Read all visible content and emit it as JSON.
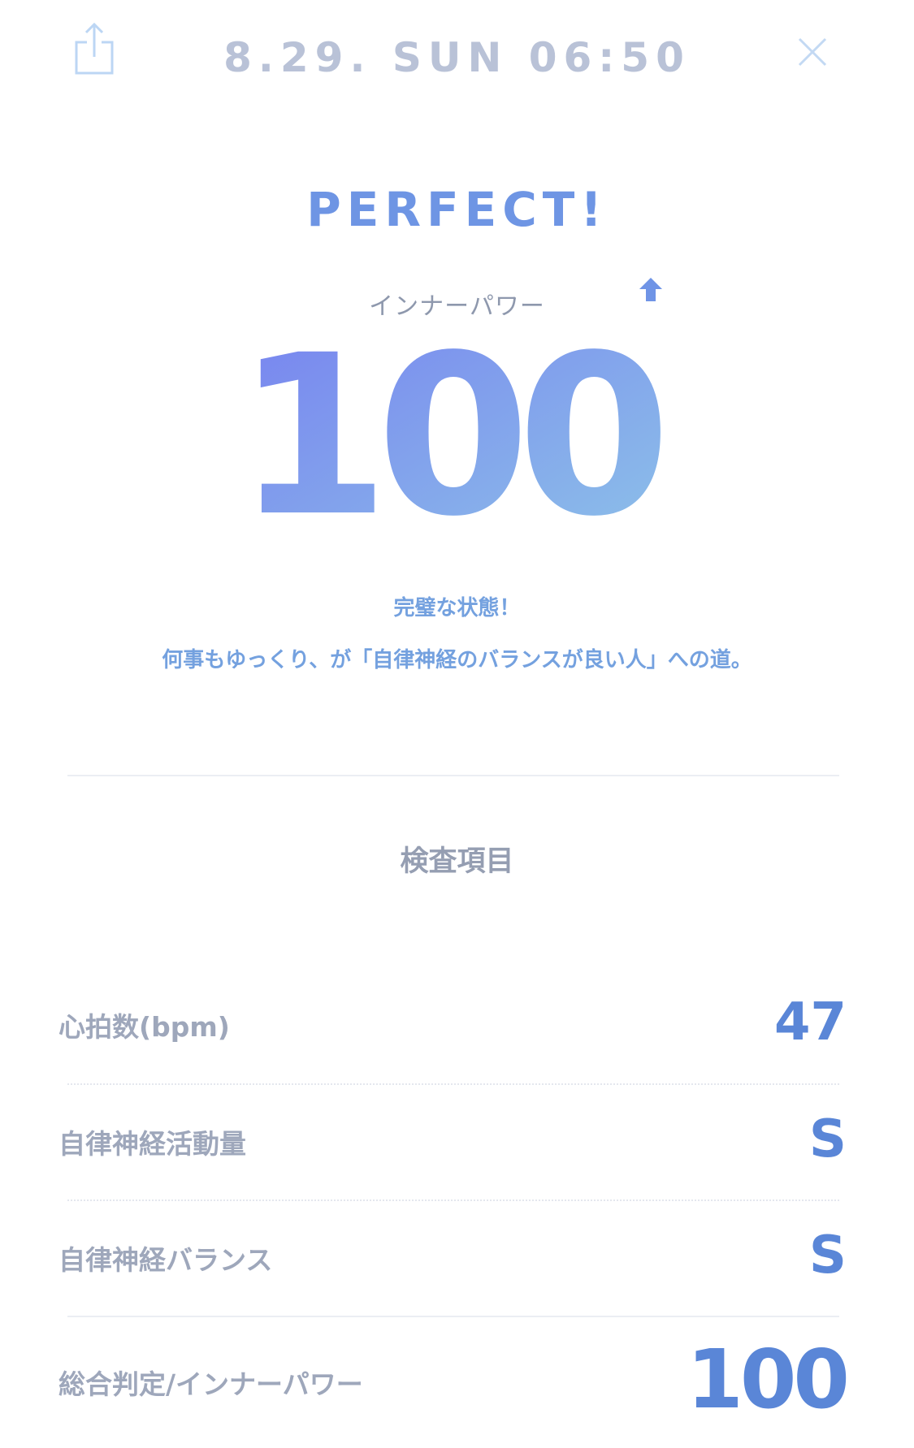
{
  "header": {
    "datetime": "8.29. SUN 06:50",
    "share_icon": "share-icon",
    "close_icon": "close-icon"
  },
  "result": {
    "headline": "PERFECT!",
    "score_label": "インナーパワー",
    "score": "100",
    "trend_icon": "up-arrow-icon",
    "message_line1": "完璧な状態！",
    "message_line2": "何事もゆっくり、が「自律神経のバランスが良い人」への道。"
  },
  "items": {
    "title": "検査項目",
    "rows": [
      {
        "label": "心拍数(bpm)",
        "value": "47"
      },
      {
        "label": "自律神経活動量",
        "value": "S"
      },
      {
        "label": "自律神経バランス",
        "value": "S"
      },
      {
        "label": "総合判定/インナーパワー",
        "value": "100"
      }
    ]
  },
  "colors": {
    "accent": "#6e95e4",
    "score_gradient_start": "#7781f0",
    "score_gradient_end": "#8dc3e8",
    "muted_text": "#9ea7bb",
    "header_text": "#b9c2d7",
    "icon": "#bcd6f4"
  }
}
